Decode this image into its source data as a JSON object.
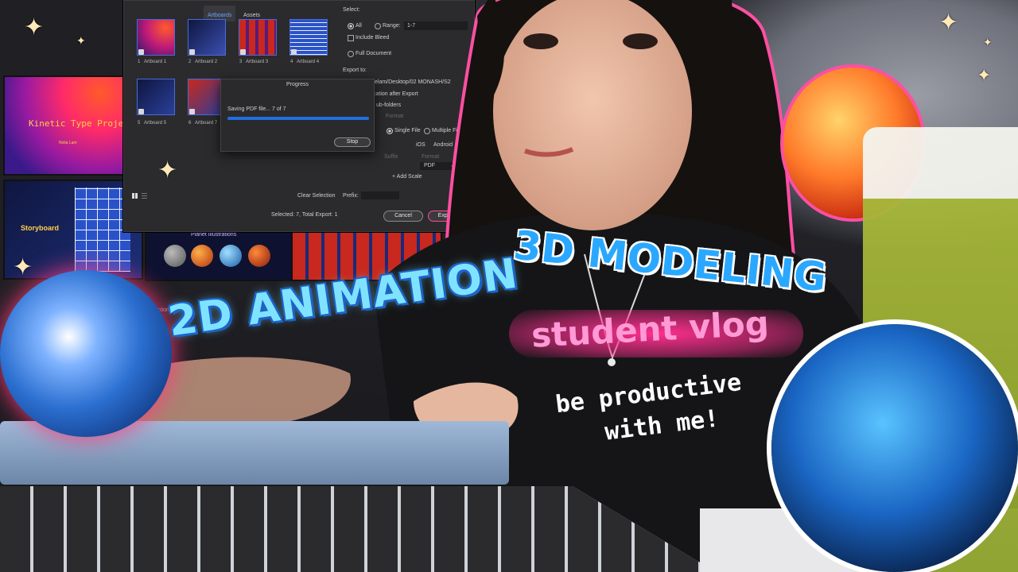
{
  "dialog": {
    "tabs": [
      "Artboards",
      "Assets"
    ],
    "artboards": [
      {
        "num": "1",
        "label": "Artboard 1"
      },
      {
        "num": "2",
        "label": "Artboard 2"
      },
      {
        "num": "3",
        "label": "Artboard 3"
      },
      {
        "num": "4",
        "label": "Artboard 4"
      },
      {
        "num": "5",
        "label": "Artboard 5"
      },
      {
        "num": "6",
        "label": "Artboard 7"
      }
    ],
    "select_label": "Select:",
    "all_label": "All",
    "range_label": "Range:",
    "range_value": "1-7",
    "include_bleed": "Include Bleed",
    "full_document": "Full Document",
    "export_to": "Export to:",
    "path": "elam/Desktop/02 MONASH/S2",
    "open_location": "cation after Export",
    "subfolders": "ub-folders",
    "format_hint": "Format",
    "single_file": "Single File",
    "multiple_files": "Multiple Files",
    "ios": "iOS",
    "android": "Android",
    "suffix_header": "Suffix",
    "format_header": "Format",
    "format_value": "PDF",
    "add_scale": "+ Add Scale",
    "clear_selection": "Clear Selection",
    "prefix_label": "Prefix:",
    "selected_status": "Selected: 7, Total Export: 1",
    "cancel": "Cancel",
    "export_artboard": "Export Artb"
  },
  "progress": {
    "title": "Progress",
    "message": "Saving PDF file... 7 of 7",
    "fraction": 1.0,
    "stop": "Stop"
  },
  "slides": {
    "kinetic": "Kinetic Type Project",
    "kinetic_sub": "Nolia Lam",
    "storyboard": "Storyboard",
    "planet": "Planet Illustrations",
    "planet_small": "ction"
  },
  "overlay": {
    "title_2d": "2D ANIMATION",
    "title_3d": "3D MODELING",
    "student_vlog": "student vlog",
    "productive_1": "be productive",
    "productive_2": "with me!"
  },
  "colors": {
    "accent_blue": "#2aa8ff",
    "light_blue": "#7fe3ff",
    "pink": "#ff5fb0",
    "progress_fill": "#1f6fe0"
  }
}
